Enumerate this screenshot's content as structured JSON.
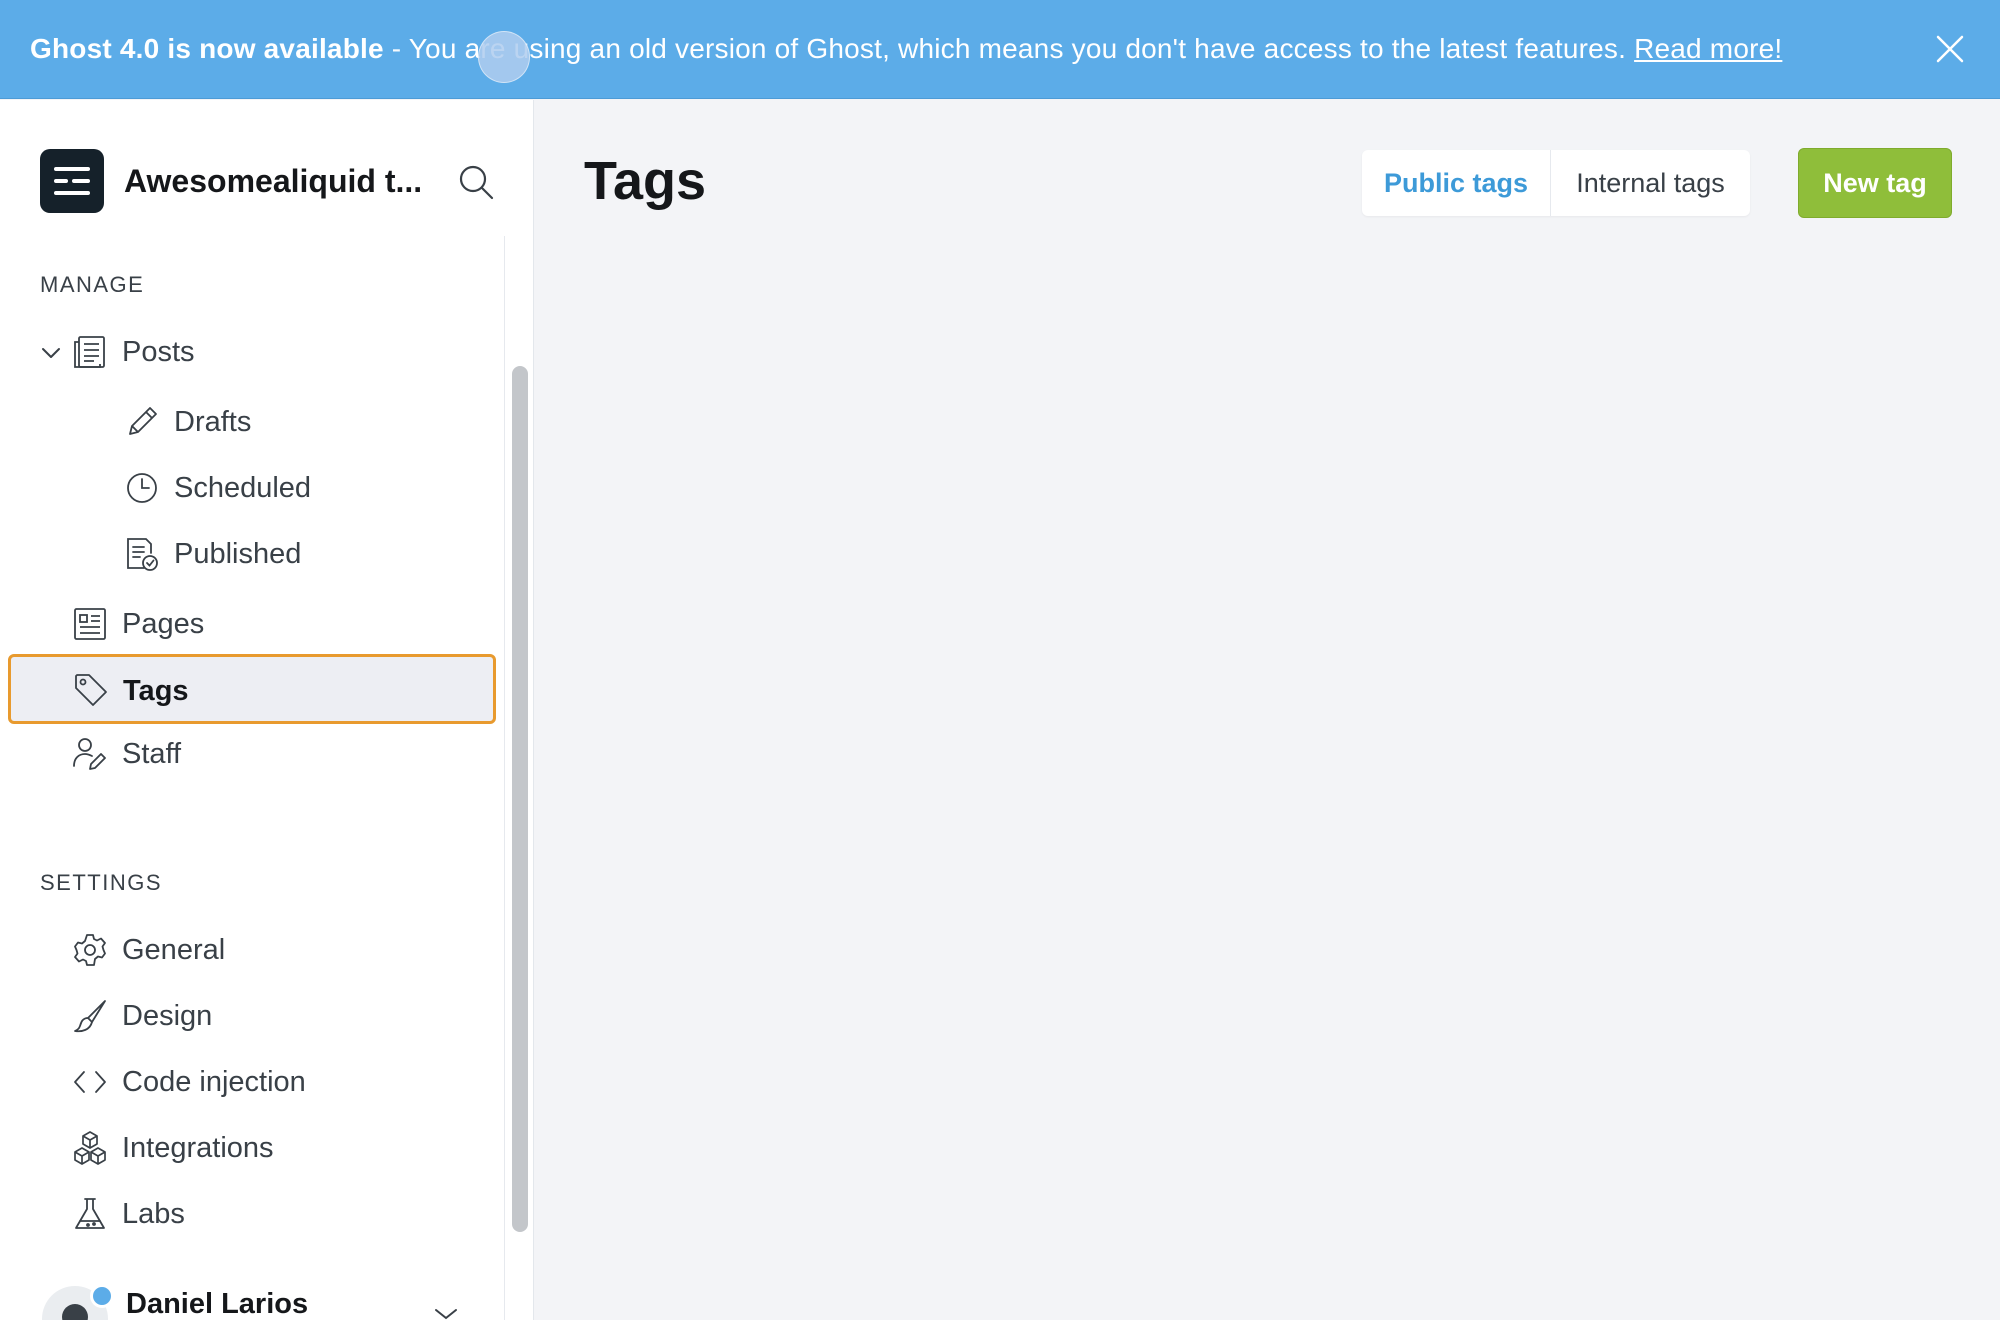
{
  "banner": {
    "headline": "Ghost 4.0 is now available",
    "separator": " - ",
    "message": "You are using an old version of Ghost, which means you don't have access to the latest features.",
    "link_label": "Read more!",
    "close_icon": "close-icon"
  },
  "sidebar": {
    "brand_title": "Awesomealiquid t...",
    "search_icon": "search-icon",
    "manage_label": "MANAGE",
    "settings_label": "SETTINGS",
    "manage_items": [
      {
        "label": "Posts",
        "icon": "posts-icon"
      },
      {
        "label": "Drafts",
        "icon": "pencil-icon"
      },
      {
        "label": "Scheduled",
        "icon": "clock-icon"
      },
      {
        "label": "Published",
        "icon": "published-icon"
      },
      {
        "label": "Pages",
        "icon": "pages-icon"
      },
      {
        "label": "Tags",
        "icon": "tag-icon",
        "active": true
      },
      {
        "label": "Staff",
        "icon": "staff-icon"
      }
    ],
    "settings_items": [
      {
        "label": "General",
        "icon": "gear-icon"
      },
      {
        "label": "Design",
        "icon": "brush-icon"
      },
      {
        "label": "Code injection",
        "icon": "code-icon"
      },
      {
        "label": "Integrations",
        "icon": "integrations-icon"
      },
      {
        "label": "Labs",
        "icon": "flask-icon"
      }
    ],
    "user_name": "Daniel Larios"
  },
  "main": {
    "title": "Tags",
    "tabs": [
      {
        "label": "Public tags",
        "active": true
      },
      {
        "label": "Internal tags",
        "active": false
      }
    ],
    "new_tag_label": "New tag"
  },
  "colors": {
    "banner": "#5cace8",
    "accent_green": "#8fbe3a",
    "active_outline": "#e89a2e",
    "tab_active": "#3d9ad8"
  }
}
